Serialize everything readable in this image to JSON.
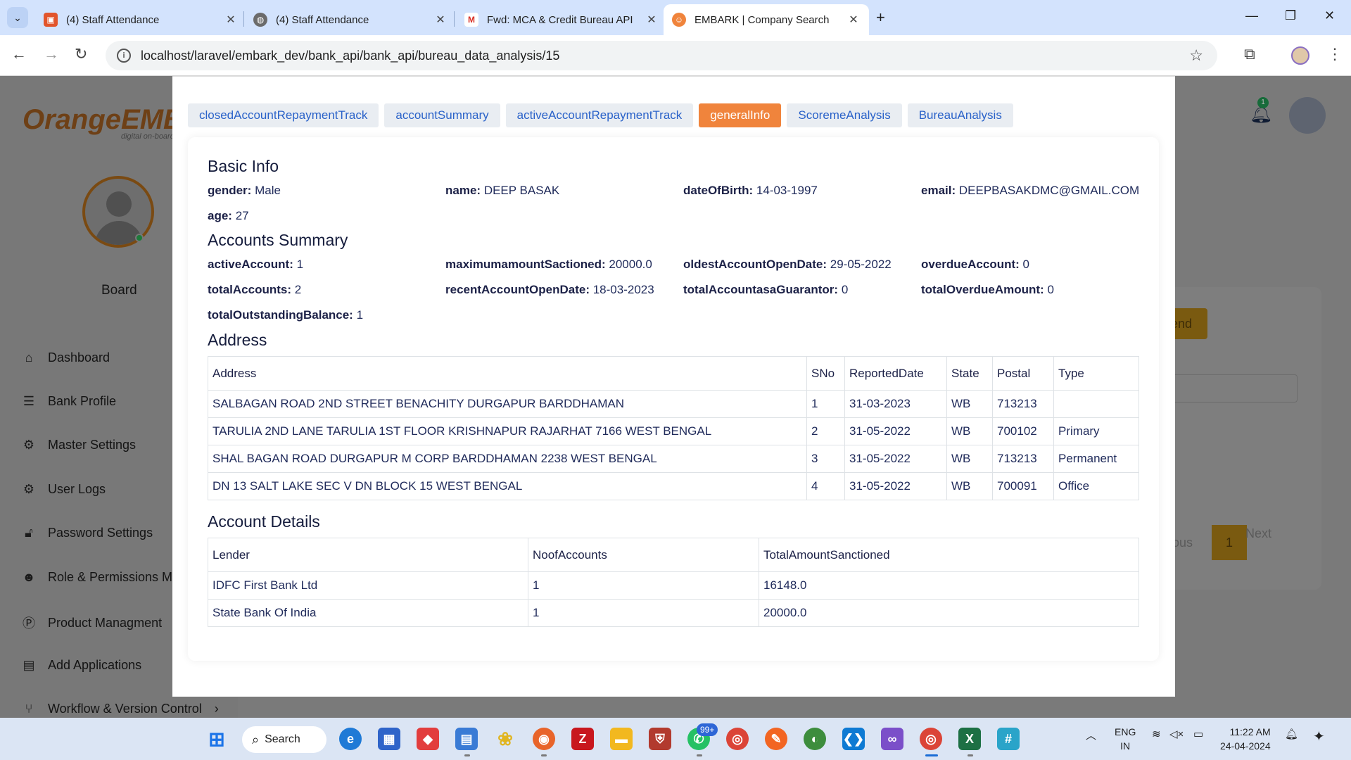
{
  "browser": {
    "tabs": [
      {
        "title": "(4) Staff Attendance",
        "active": false,
        "favicon": "app-favicon-icon"
      },
      {
        "title": "(4) Staff Attendance",
        "active": false,
        "favicon": "globe-icon"
      },
      {
        "title": "Fwd: MCA & Credit Bureau API",
        "active": false,
        "favicon": "gmail-icon"
      },
      {
        "title": "EMBARK | Company Search",
        "active": true,
        "favicon": "embark-favicon-icon"
      }
    ],
    "url": "localhost/laravel/embark_dev/bank_api/bank_api/bureau_data_analysis/15"
  },
  "app": {
    "logo_text": "OrangeEMBA",
    "logo_sub": "digital on-board",
    "board_label": "Board",
    "notification_count": "1",
    "sidebar": [
      {
        "label": "Dashboard",
        "icon": "home-icon"
      },
      {
        "label": "Bank Profile",
        "icon": "list-icon"
      },
      {
        "label": "Master Settings",
        "icon": "gear-icon"
      },
      {
        "label": "User Logs",
        "icon": "gears-icon"
      },
      {
        "label": "Password Settings",
        "icon": "lock-icon"
      },
      {
        "label": "Role & Permissions Ma",
        "icon": "users-icon"
      },
      {
        "label": "Product Managment",
        "icon": "product-icon"
      },
      {
        "label": "Add Applications",
        "icon": "document-icon"
      },
      {
        "label": "Workflow & Version Control",
        "icon": "branch-icon"
      }
    ],
    "bg_send": "end",
    "bg_prev": "ious",
    "bg_page": "1",
    "bg_next": "Next"
  },
  "modal": {
    "tabs": [
      {
        "label": "closedAccountRepaymentTrack",
        "active": false
      },
      {
        "label": "accountSummary",
        "active": false
      },
      {
        "label": "activeAccountRepaymentTrack",
        "active": false
      },
      {
        "label": "generalInfo",
        "active": true
      },
      {
        "label": "ScoremeAnalysis",
        "active": false
      },
      {
        "label": "BureauAnalysis",
        "active": false
      }
    ],
    "basic_info": {
      "title": "Basic Info",
      "fields": [
        {
          "key": "gender:",
          "value": "Male"
        },
        {
          "key": "name:",
          "value": "DEEP BASAK"
        },
        {
          "key": "dateOfBirth:",
          "value": "14-03-1997"
        },
        {
          "key": "email:",
          "value": "DEEPBASAKDMC@GMAIL.COM"
        },
        {
          "key": "age:",
          "value": "27"
        }
      ]
    },
    "accounts_summary": {
      "title": "Accounts Summary",
      "fields": [
        {
          "key": "activeAccount:",
          "value": "1"
        },
        {
          "key": "maximumamountSactioned:",
          "value": "20000.0"
        },
        {
          "key": "oldestAccountOpenDate:",
          "value": "29-05-2022"
        },
        {
          "key": "overdueAccount:",
          "value": "0"
        },
        {
          "key": "totalAccounts:",
          "value": "2"
        },
        {
          "key": "recentAccountOpenDate:",
          "value": "18-03-2023"
        },
        {
          "key": "totalAccountasaGuarantor:",
          "value": "0"
        },
        {
          "key": "totalOverdueAmount:",
          "value": "0"
        },
        {
          "key": "totalOutstandingBalance:",
          "value": "1"
        }
      ]
    },
    "address": {
      "title": "Address",
      "headers": [
        "Address",
        "SNo",
        "ReportedDate",
        "State",
        "Postal",
        "Type"
      ],
      "rows": [
        [
          "SALBAGAN ROAD 2ND STREET BENACHITY DURGAPUR BARDDHAMAN",
          "1",
          "31-03-2023",
          "WB",
          "713213",
          ""
        ],
        [
          "TARULIA 2ND LANE TARULIA 1ST FLOOR KRISHNAPUR RAJARHAT 7166 WEST BENGAL",
          "2",
          "31-05-2022",
          "WB",
          "700102",
          "Primary"
        ],
        [
          "SHAL BAGAN ROAD DURGAPUR M CORP BARDDHAMAN 2238 WEST BENGAL",
          "3",
          "31-05-2022",
          "WB",
          "713213",
          "Permanent"
        ],
        [
          "DN 13 SALT LAKE SEC V DN BLOCK 15 WEST BENGAL",
          "4",
          "31-05-2022",
          "WB",
          "700091",
          "Office"
        ]
      ]
    },
    "account_details": {
      "title": "Account Details",
      "headers": [
        "Lender",
        "NoofAccounts",
        "TotalAmountSanctioned"
      ],
      "rows": [
        [
          "IDFC First Bank Ltd",
          "1",
          "16148.0"
        ],
        [
          "State Bank Of India",
          "1",
          "20000.0"
        ]
      ]
    }
  },
  "taskbar": {
    "search_label": "Search",
    "whatsapp_badge": "99+",
    "lang_line1": "ENG",
    "lang_line2": "IN",
    "time": "11:22 AM",
    "date": "24-04-2024"
  },
  "colors": {
    "active_tab": "#f0843c",
    "tab_text": "#2a62c9",
    "heading": "#151c3c",
    "brand_orange": "#e47b16"
  }
}
